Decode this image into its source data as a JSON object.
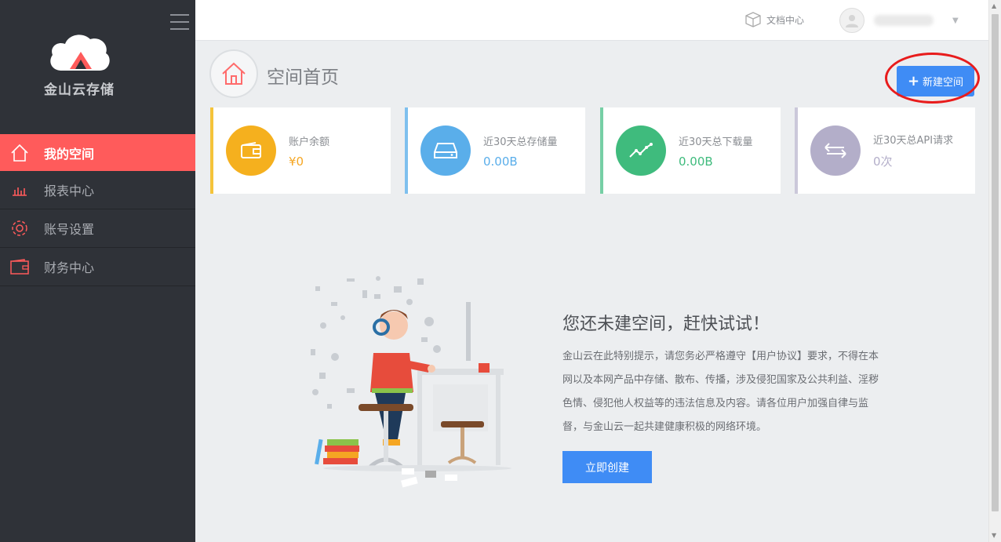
{
  "sidebar": {
    "logo_text": "金山云存储",
    "items": [
      {
        "label": "我的空间",
        "icon": "home-icon",
        "active": true
      },
      {
        "label": "报表中心",
        "icon": "bar-chart-icon"
      },
      {
        "label": "账号设置",
        "icon": "gear-icon"
      },
      {
        "label": "财务中心",
        "icon": "wallet-icon"
      }
    ]
  },
  "topbar": {
    "docs_label": "文档中心",
    "docs_icon": "box-icon",
    "avatar_icon": "user-avatar-icon",
    "menu_icon": "hamburger-icon"
  },
  "header": {
    "title": "空间首页",
    "new_space_label": "新建空间",
    "new_space_plus": "+"
  },
  "stats": [
    {
      "label": "账户余额",
      "value": "¥0",
      "color": "#f5b01e",
      "icon": "wallet-icon"
    },
    {
      "label": "近30天总存储量",
      "value": "0.00B",
      "color": "#5aaeea",
      "icon": "hard-drive-icon"
    },
    {
      "label": "近30天总下载量",
      "value": "0.00B",
      "color": "#3fbb7d",
      "icon": "trend-line-icon"
    },
    {
      "label": "近30天总API请求",
      "value": "0次",
      "color": "#b3aec9",
      "icon": "swap-arrows-icon"
    }
  ],
  "empty_state": {
    "title": "您还未建空间，赶快试试！",
    "description": "金山云在此特别提示，请您务必严格遵守【用户协议】要求，不得在本网以及本网产品中存储、散布、传播，涉及侵犯国家及公共利益、淫秽色情、侵犯他人权益等的违法信息及内容。请各位用户加强自律与监督，与金山云一起共建健康积极的网络环境。",
    "create_label": "立即创建"
  },
  "colors": {
    "sidebar_bg": "#2f3238",
    "active_nav": "#ff5b5b",
    "primary": "#3f8cf5",
    "highlight_ring": "#e81c1c"
  }
}
